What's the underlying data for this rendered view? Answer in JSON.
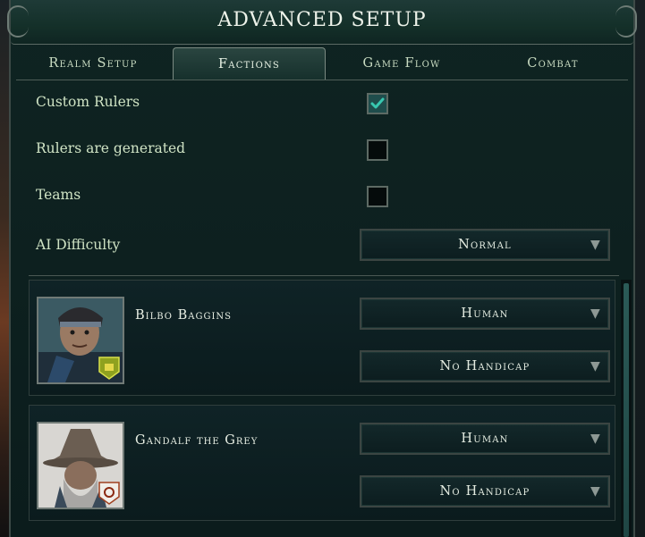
{
  "header": {
    "title": "Advanced Setup"
  },
  "tabs": [
    {
      "label": "Realm Setup",
      "active": false
    },
    {
      "label": "Factions",
      "active": true
    },
    {
      "label": "Game Flow",
      "active": false
    },
    {
      "label": "Combat",
      "active": false
    }
  ],
  "settings": {
    "custom_rulers": {
      "label": "Custom Rulers",
      "checked": true
    },
    "rulers_generated": {
      "label": "Rulers are generated",
      "checked": false
    },
    "teams": {
      "label": "Teams",
      "checked": false
    },
    "ai_difficulty": {
      "label": "AI Difficulty",
      "value": "Normal"
    }
  },
  "players": [
    {
      "name": "Bilbo Baggins",
      "type": "Human",
      "handicap": "No Handicap"
    },
    {
      "name": "Gandalf the Grey",
      "type": "Human",
      "handicap": "No Handicap"
    }
  ],
  "colors": {
    "accent": "#1f4d4c",
    "check": "#38c7b0",
    "text": "#cfe3c4"
  }
}
